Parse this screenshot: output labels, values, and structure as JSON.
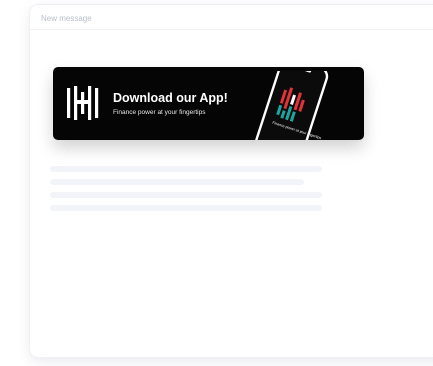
{
  "window": {
    "title": "New message"
  },
  "banner": {
    "title": "Download our App!",
    "subtitle": "Finance power at your fingertips",
    "phone_text": "Finance power at your fingertips"
  },
  "colors": {
    "banner_bg": "#050505",
    "logo": "#ffffff",
    "phone_accent_red": "#e3323a",
    "phone_accent_teal": "#1ca6a0",
    "skeleton": "#f3f4f9"
  },
  "icons": {
    "logo": "brand-logo-icon",
    "phone": "phone-mockup-icon"
  }
}
